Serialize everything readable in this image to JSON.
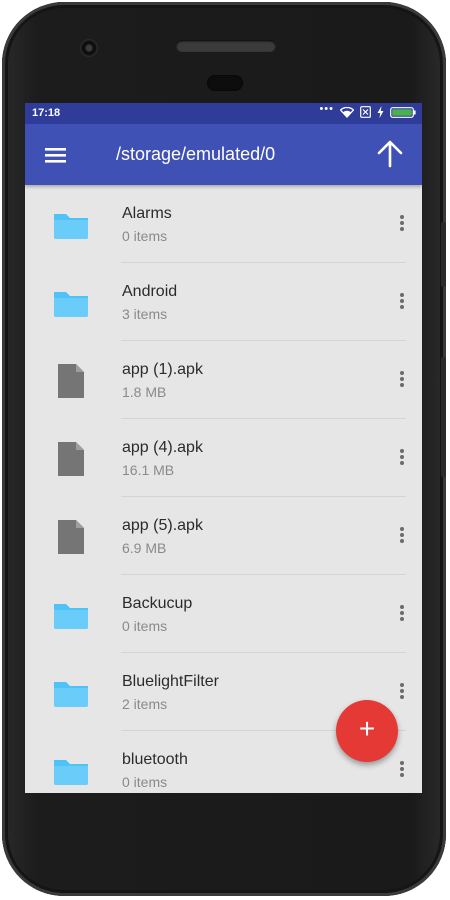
{
  "status_bar": {
    "time": "17:18",
    "icons": [
      "more-dots-icon",
      "wifi-icon",
      "no-sim-icon",
      "charging-icon",
      "battery-icon"
    ],
    "color": "#2f3c9a"
  },
  "app_bar": {
    "title": "/storage/emulated/0",
    "menu_icon": "hamburger-menu-icon",
    "up_icon": "arrow-up-icon",
    "color": "#3f51b5"
  },
  "files": [
    {
      "name": "Alarms",
      "meta": "0 items",
      "type": "folder"
    },
    {
      "name": "Android",
      "meta": "3 items",
      "type": "folder"
    },
    {
      "name": "app (1).apk",
      "meta": "1.8 MB",
      "type": "file"
    },
    {
      "name": "app (4).apk",
      "meta": "16.1 MB",
      "type": "file"
    },
    {
      "name": "app (5).apk",
      "meta": "6.9 MB",
      "type": "file"
    },
    {
      "name": "Backucup",
      "meta": "0 items",
      "type": "folder"
    },
    {
      "name": "BluelightFilter",
      "meta": "2 items",
      "type": "folder"
    },
    {
      "name": "bluetooth",
      "meta": "0 items",
      "type": "folder"
    }
  ],
  "fab": {
    "label": "+",
    "icon": "add-icon",
    "color": "#e53935"
  },
  "colors": {
    "folder": "#4fc3f7",
    "file": "#757575",
    "background": "#e6e6e6"
  }
}
